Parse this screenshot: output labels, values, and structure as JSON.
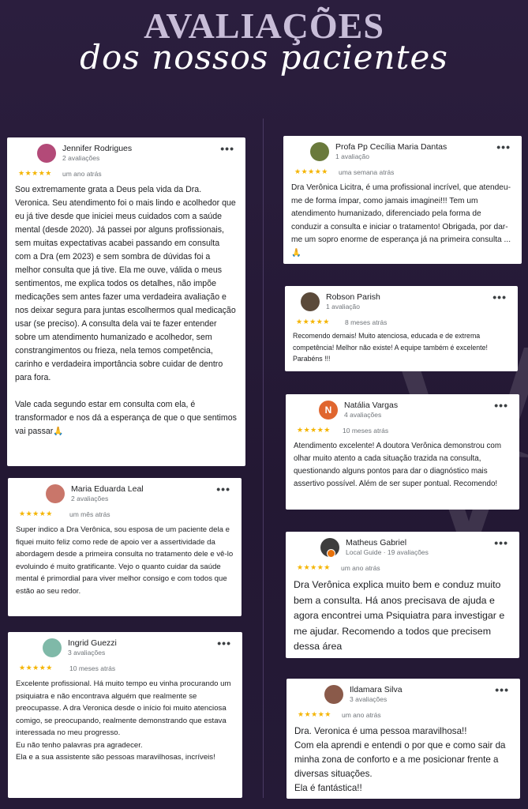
{
  "header": {
    "title_line1": "AVALIAÇÕES",
    "title_line2": "dos nossos pacientes"
  },
  "colors": {
    "background": "#2a1d3c",
    "star": "#f4b400",
    "card": "#ffffff"
  },
  "reviews": [
    {
      "name": "Jennifer Rodrigues",
      "meta": "2 avaliações",
      "stars": "★★★★★",
      "when": "um ano atrás",
      "text": "Sou extremamente grata a Deus pela vida da Dra. Veronica. Seu atendimento foi o mais lindo e acolhedor que eu já tive desde que iniciei meus cuidados com a saúde mental (desde 2020). Já passei por alguns profissionais, sem muitas expectativas acabei passando em consulta com a Dra (em 2023) e sem sombra de dúvidas foi a melhor consulta que já tive. Ela me ouve, válida o meus sentimentos, me explica todos os detalhes, não impõe medicações sem antes fazer uma verdadeira avaliação e nos deixar segura para juntas escolhermos qual medicação usar (se preciso). A consulta dela vai te fazer entender sobre um atendimento humanizado e acolhedor, sem constrangimentos ou frieza, nela temos competência, carinho e verdadeira importância sobre cuidar de dentro para fora.\n\nVale cada segundo estar em consulta com ela, é transformador e nos dá a esperança de que o que sentimos vai passar🙏",
      "avatar_color": "#b34a78",
      "avatar_icon": "user-photo-icon"
    },
    {
      "name": "Maria Eduarda Leal",
      "meta": "2 avaliações",
      "stars": "★★★★★",
      "when": "um mês atrás",
      "text": "Super indico a Dra Verônica, sou esposa de um paciente dela e fiquei muito feliz como rede de apoio ver a assertividade da abordagem desde a primeira consulta no tratamento dele e vê-lo evoluindo é muito gratificante. Vejo o quanto cuidar da saúde mental é primordial para viver melhor consigo e com todos que estão ao seu redor.",
      "avatar_color": "#c9766a",
      "avatar_icon": "user-photo-icon"
    },
    {
      "name": "Ingrid Guezzi",
      "meta": "3 avaliações",
      "stars": "★★★★★",
      "when": "10 meses atrás",
      "text": "Excelente profissional. Há muito tempo eu vinha procurando um psiquiatra e não encontrava alguém que realmente se preocupasse. A dra Veronica desde o início foi muito atenciosa comigo, se preocupando, realmente demonstrando que estava interessada no meu progresso.\nEu não tenho palavras pra agradecer.\nEla e a sua assistente são pessoas maravilhosas, incríveis!",
      "avatar_color": "#7fb9a8",
      "avatar_icon": "user-photo-icon"
    },
    {
      "name": "Profa Pp Cecília Maria Dantas",
      "meta": "1 avaliação",
      "stars": "★★★★★",
      "when": "uma semana atrás",
      "text": "Dra Verônica Licitra, é uma profissional incrível, que atendeu-me de forma ímpar, como jamais imaginei!!! Tem um atendimento humanizado, diferenciado pela forma de conduzir a consulta e iniciar o tratamento! Obrigada, por dar-me um sopro enorme de esperança já na primeira consulta ...🙏",
      "avatar_color": "#6a7a3c",
      "avatar_icon": "user-photo-icon"
    },
    {
      "name": "Robson Parish",
      "meta": "1 avaliação",
      "stars": "★★★★★",
      "when": "8 meses atrás",
      "text": "Recomendo demais! Muito atenciosa, educada e de extrema competência! Melhor não existe! A equipe também é excelente! Parabéns !!!",
      "avatar_color": "#5b4a3a",
      "avatar_icon": "user-photo-icon"
    },
    {
      "name": "Natália Vargas",
      "meta": "4 avaliações",
      "stars": "★★★★★",
      "when": "10 meses atrás",
      "text": "Atendimento excelente! A doutora Verônica demonstrou com olhar muito atento a cada situação trazida na consulta, questionando alguns pontos para dar o diagnóstico mais assertivo possível. Além de ser super pontual. Recomendo!",
      "avatar_color": "#e0662f",
      "avatar_letter": "N",
      "avatar_icon": "letter-avatar-icon"
    },
    {
      "name": "Matheus Gabriel",
      "meta": "Local Guide · 19 avaliações",
      "stars": "★★★★★",
      "when": "um ano atrás",
      "text": "Dra Verônica explica muito bem e conduz muito bem a consulta. Há anos precisava de ajuda e agora encontrei uma Psiquiatra para investigar e me ajudar. Recomendo a todos que precisem dessa área",
      "avatar_color": "#3d3d3d",
      "avatar_icon": "user-photo-icon"
    },
    {
      "name": "Ildamara Silva",
      "meta": "3 avaliações",
      "stars": "★★★★★",
      "when": "um ano atrás",
      "text": "Dra. Veronica é uma pessoa maravilhosa!!\nCom ela aprendi e entendi o por que e como sair da minha zona de conforto e a me posicionar frente a diversas situações.\nEla é fantástica!!",
      "avatar_color": "#8a5a4a",
      "avatar_icon": "user-photo-icon"
    }
  ],
  "menu_icon": "more-options-icon",
  "menu_label": "•••"
}
